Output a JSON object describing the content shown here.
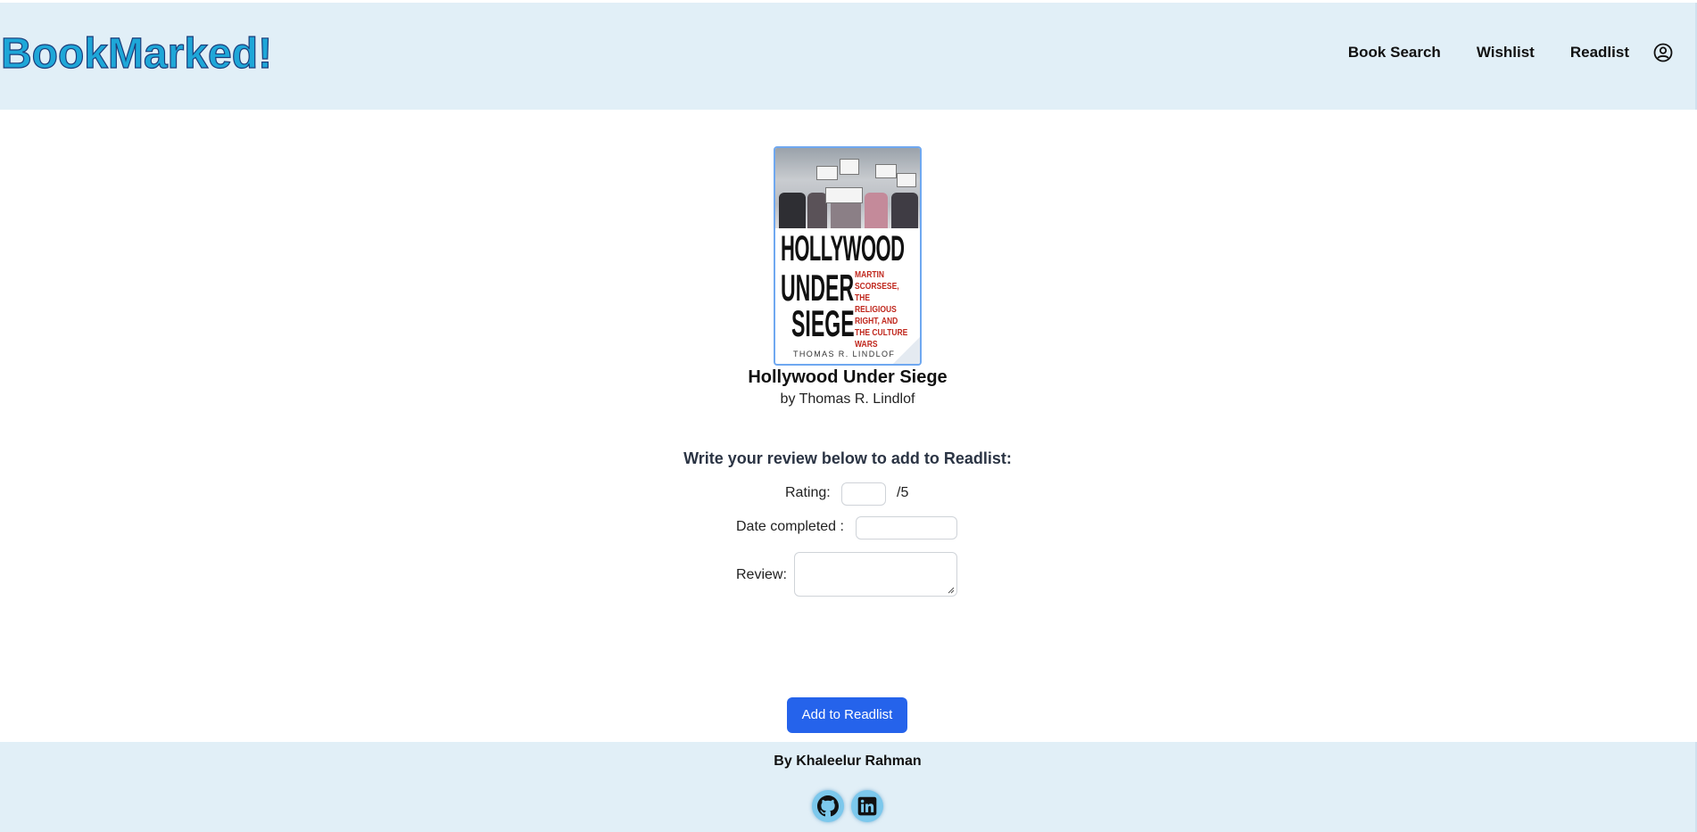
{
  "header": {
    "logo": "BookMarked!",
    "nav": {
      "book_search": "Book Search",
      "wishlist": "Wishlist",
      "readlist": "Readlist"
    },
    "account_icon": "user-circle-icon"
  },
  "book": {
    "cover": {
      "title_line1": "HOLLYWOOD",
      "title_line2": "UNDER",
      "title_line3": "SIEGE",
      "subtitle": "MARTIN SCORSESE, THE RELIGIOUS RIGHT, AND THE CULTURE WARS",
      "author": "THOMAS R. LINDLOF"
    },
    "title": "Hollywood Under Siege",
    "author_line": "by Thomas R. Lindlof"
  },
  "review_form": {
    "heading": "Write your review below to add to Readlist:",
    "rating_label": "Rating:",
    "rating_value": "",
    "rating_suffix": "/5",
    "date_label": "Date completed :",
    "date_value": "",
    "review_label": "Review:",
    "review_value": "",
    "submit_label": "Add to Readlist"
  },
  "footer": {
    "credit": "By Khaleelur Rahman",
    "social": [
      "github-icon",
      "linkedin-icon"
    ]
  },
  "colors": {
    "header_bg": "#e1eff7",
    "logo_fill": "#1ea7d8",
    "logo_outline": "#1d3d7a",
    "button_bg": "#2563eb",
    "cover_border": "#6fa8f0",
    "social_bg": "#7cc8ec"
  }
}
